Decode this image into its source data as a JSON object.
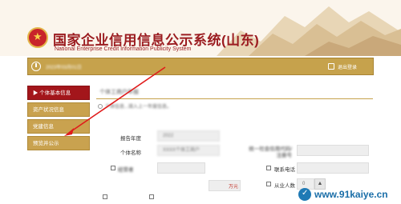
{
  "header": {
    "title_cn": "国家企业信用信息公示系统(山东)",
    "title_en": "National Enterprise Credit Information Publicity System"
  },
  "topbar": {
    "date": "2023年03月01日",
    "exit_label": "退出登录"
  },
  "sidebar": {
    "items": [
      {
        "label": "▶ 个体基本信息"
      },
      {
        "label": "资产状况信息"
      },
      {
        "label": "党建信息"
      },
      {
        "label": "预览并公示"
      }
    ]
  },
  "main": {
    "tab_title": "个体工商户年报",
    "notice": "个体信息...填入上一年度信息。",
    "form": {
      "year_label": "报告年度",
      "year_value": "2022",
      "name_label": "个体名称",
      "name_value": "XXXX个体工商户",
      "code_label": "统一社会信用代码/注册号",
      "code_value": "",
      "operator_label": "经营者",
      "capital_unit": "万元",
      "phone_label": "联系电话",
      "staff_label": "从业人数",
      "staff_value": "0"
    }
  },
  "watermark": {
    "text": "www.91kaiye.cn"
  },
  "colors": {
    "brand_red": "#a3161b",
    "gold": "#c6a24c",
    "arrow_red": "#e01b1b",
    "watermark_blue": "#1a6ea8"
  }
}
